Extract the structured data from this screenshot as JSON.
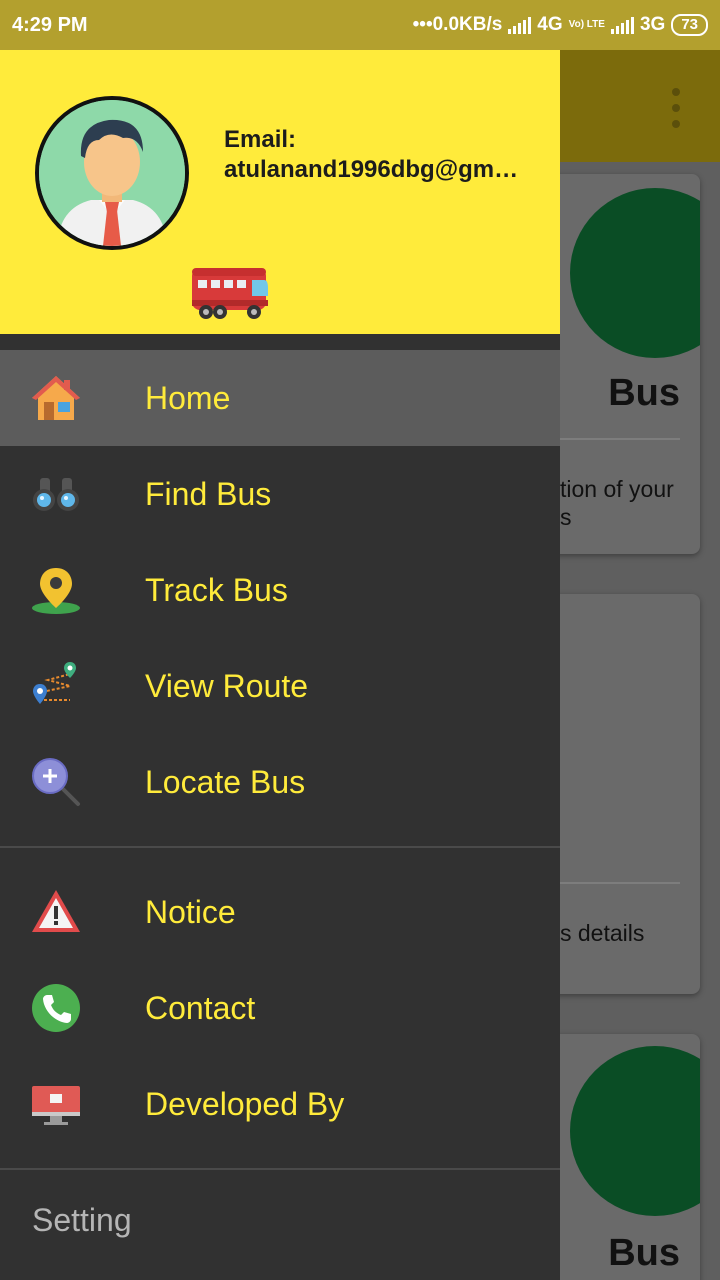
{
  "status_bar": {
    "time": "4:29 PM",
    "net_speed": "•••0.0KB/s",
    "network_1": "4G",
    "volte": "Vo) LTE",
    "network_2": "3G",
    "battery": "73"
  },
  "background": {
    "card1_title": "Bus",
    "card1_desc_line1": "tion of your",
    "card1_desc_line2": "s",
    "card2_desc": "s details",
    "card3_title": "Bus"
  },
  "drawer": {
    "email_label": "Email:",
    "email_value": "atulanand1996dbg@gm…",
    "items": [
      {
        "label": "Home",
        "icon": "home-icon"
      },
      {
        "label": "Find Bus",
        "icon": "binoculars-icon"
      },
      {
        "label": "Track Bus",
        "icon": "location-pin-icon"
      },
      {
        "label": "View Route",
        "icon": "route-icon"
      },
      {
        "label": "Locate Bus",
        "icon": "zoom-in-icon"
      }
    ],
    "secondary_items": [
      {
        "label": "Notice",
        "icon": "warning-icon"
      },
      {
        "label": "Contact",
        "icon": "phone-icon"
      },
      {
        "label": "Developed By",
        "icon": "monitor-icon"
      }
    ],
    "setting_label": "Setting"
  },
  "colors": {
    "accent": "#ffeb3b",
    "drawer_bg": "#313131",
    "active_item_bg": "#5c5c5c",
    "status_bar": "#b3a02e"
  }
}
